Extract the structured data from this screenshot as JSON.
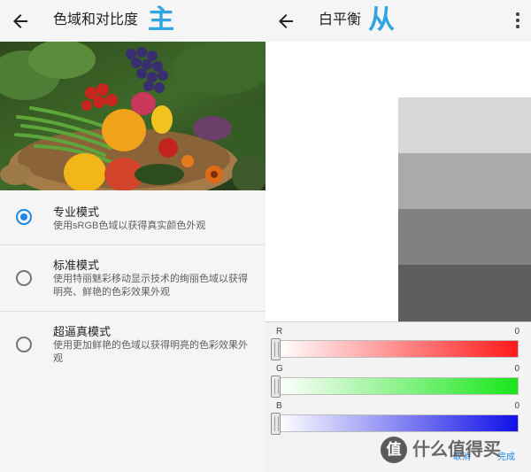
{
  "left": {
    "title": "色域和对比度",
    "overlay_label": "主",
    "hero_image": "vegetable-basket-photo",
    "options": [
      {
        "name": "专业模式",
        "desc": "使用sRGB色域以获得真实颜色外观",
        "selected": true
      },
      {
        "name": "标准模式",
        "desc": "使用特丽魅彩移动显示技术的绚丽色域以获得明亮、鲜艳的色彩效果外观",
        "selected": false
      },
      {
        "name": "超逼真模式",
        "desc": "使用更加鲜艳的色域以获得明亮的色彩效果外观",
        "selected": false
      }
    ]
  },
  "right": {
    "title": "白平衡",
    "overlay_label": "从",
    "swatches": [
      "#d7d7d7",
      "#aaaaaa",
      "#818181",
      "#5e5e5e"
    ],
    "channels": [
      {
        "label": "R",
        "value": "0",
        "color": "#ff1a1a"
      },
      {
        "label": "G",
        "value": "0",
        "color": "#19e619"
      },
      {
        "label": "B",
        "value": "0",
        "color": "#1010e8"
      }
    ],
    "cancel_label": "取消",
    "done_label": "完成"
  },
  "watermark": {
    "badge": "值",
    "text": "什么值得买"
  },
  "colors": {
    "accent": "#1e88e5",
    "overlay": "#2fa5e4"
  }
}
